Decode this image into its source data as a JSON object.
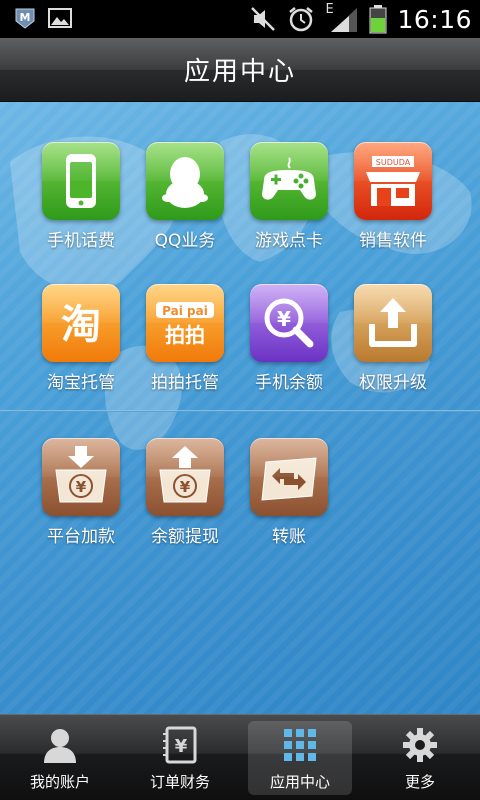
{
  "status_bar": {
    "time": "16:16",
    "network_label": "E",
    "icons": [
      "app-m-icon",
      "image-icon",
      "mute-icon",
      "alarm-icon",
      "signal-icon",
      "battery-icon"
    ]
  },
  "header": {
    "title": "应用中心"
  },
  "apps": [
    {
      "label": "手机话费",
      "icon": "phone-icon",
      "color": "#3fae26"
    },
    {
      "label": "QQ业务",
      "icon": "penguin-icon",
      "color": "#3fae26"
    },
    {
      "label": "游戏点卡",
      "icon": "gamepad-icon",
      "color": "#3fae26"
    },
    {
      "label": "销售软件",
      "icon": "store-icon",
      "color": "#e8421b",
      "badge": "SUDUDA"
    },
    {
      "label": "淘宝托管",
      "icon": "taobao-icon",
      "color": "#f58a14",
      "glyph": "淘"
    },
    {
      "label": "拍拍托管",
      "icon": "paipai-icon",
      "color": "#f58a14",
      "glyph": "拍拍",
      "badge": "Pai pai"
    },
    {
      "label": "手机余额",
      "icon": "yuan-search-icon",
      "color": "#7b45d0",
      "glyph": "¥"
    },
    {
      "label": "权限升级",
      "icon": "upload-icon",
      "color": "#d49a4a"
    }
  ],
  "finance_apps": [
    {
      "label": "平台加款",
      "icon": "deposit-icon",
      "color": "#9c5f3b",
      "glyph": "¥"
    },
    {
      "label": "余额提现",
      "icon": "withdraw-icon",
      "color": "#9c5f3b",
      "glyph": "¥"
    },
    {
      "label": "转账",
      "icon": "transfer-icon",
      "color": "#9c5f3b"
    }
  ],
  "tabs": [
    {
      "label": "我的账户",
      "icon": "user-icon",
      "active": false
    },
    {
      "label": "订单财务",
      "icon": "ledger-icon",
      "active": false,
      "glyph": "¥"
    },
    {
      "label": "应用中心",
      "icon": "grid-icon",
      "active": true
    },
    {
      "label": "更多",
      "icon": "gear-icon",
      "active": false
    }
  ]
}
